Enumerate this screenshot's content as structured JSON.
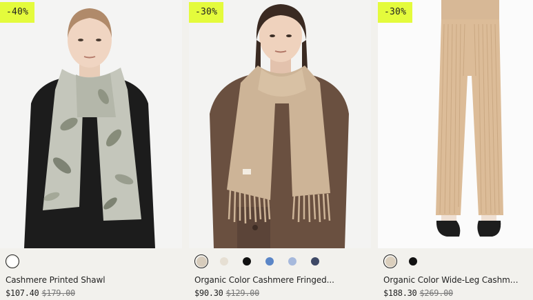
{
  "products": [
    {
      "badge": "-40%",
      "name": "Cashmere Printed Shawl",
      "price": "$107.40",
      "original_price": "$179.00",
      "image_alt": "woman wearing printed leaf shawl",
      "swatches": [
        {
          "color": "#ffffff",
          "selected": true
        }
      ]
    },
    {
      "badge": "-30%",
      "name": "Organic Color Cashmere Fringed...",
      "price": "$90.30",
      "original_price": "$129.00",
      "image_alt": "woman wearing beige fringed scarf",
      "swatches": [
        {
          "color": "#d7ccbc",
          "selected": true
        },
        {
          "color": "#e6dfd3",
          "selected": false
        },
        {
          "color": "#111111",
          "selected": false
        },
        {
          "color": "#5b86c7",
          "selected": false
        },
        {
          "color": "#a6b9dc",
          "selected": false
        },
        {
          "color": "#3e4966",
          "selected": false
        }
      ]
    },
    {
      "badge": "-30%",
      "name": "Organic Color Wide-Leg Cashmer...",
      "price": "$188.30",
      "original_price": "$269.00",
      "image_alt": "beige ribbed wide-leg pants",
      "swatches": [
        {
          "color": "#dbcfbd",
          "selected": true
        },
        {
          "color": "#111111",
          "selected": false
        }
      ]
    }
  ]
}
